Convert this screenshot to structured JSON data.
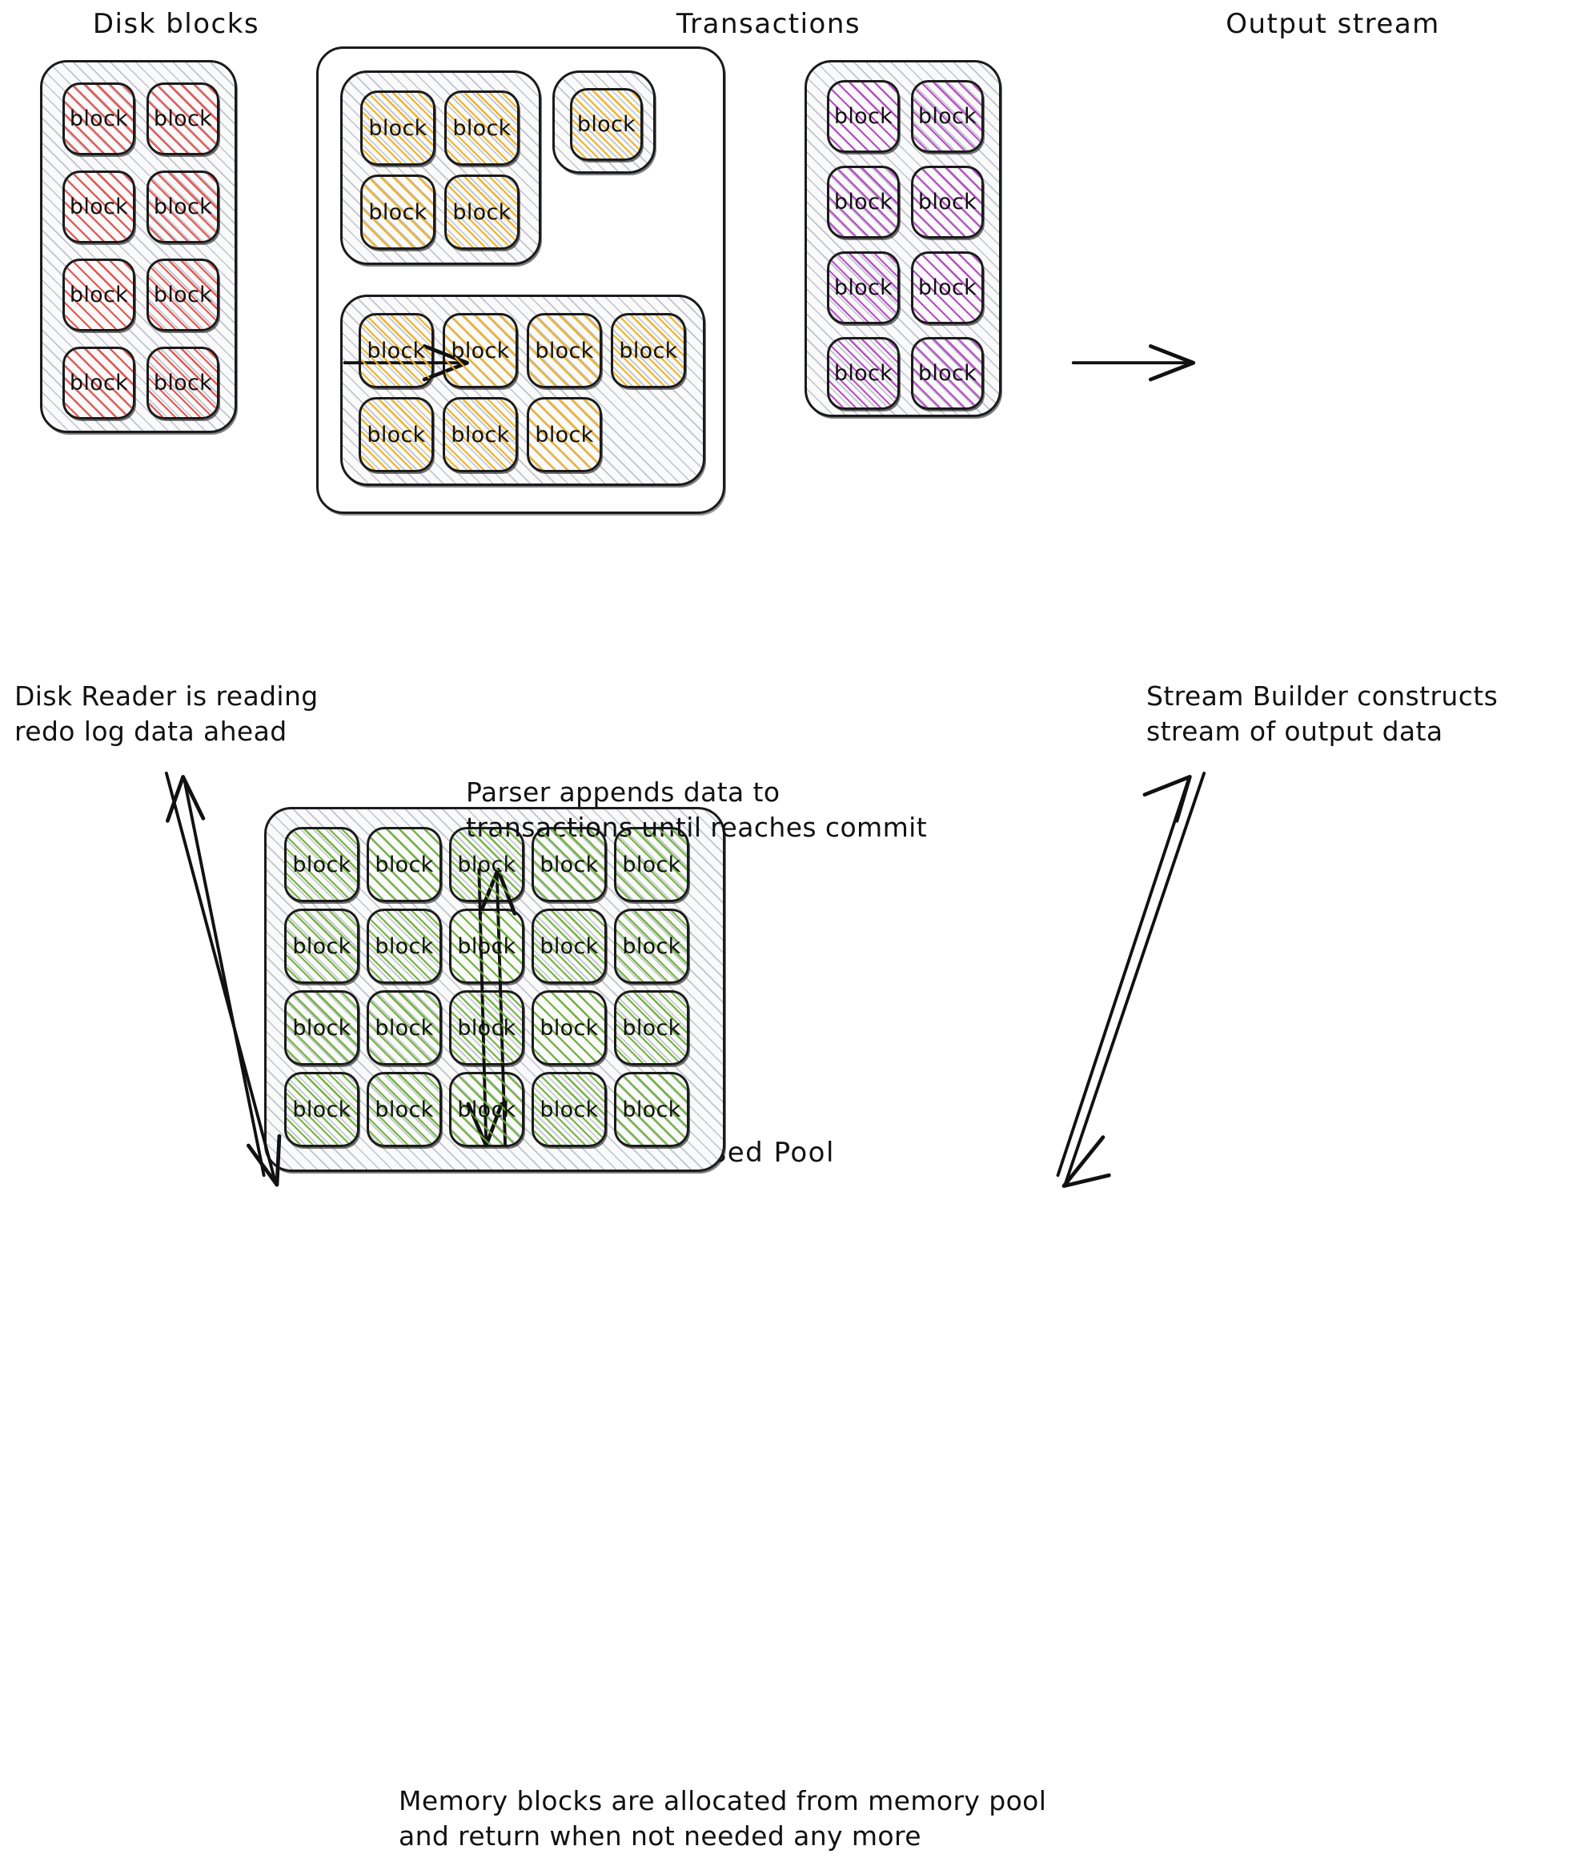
{
  "groups": {
    "disk": {
      "title": "Disk blocks",
      "block_label": "block",
      "rows": 4,
      "cols": 2,
      "count": 8,
      "color": "#e54e48",
      "blocks": [
        "block",
        "block",
        "block",
        "block",
        "block",
        "block",
        "block",
        "block"
      ]
    },
    "transactions": {
      "title": "Transactions",
      "block_label": "block",
      "color": "#f2af1c",
      "sub_boxes": [
        {
          "name": "transaction-a",
          "rows": 2,
          "cols": 2,
          "blocks": [
            "block",
            "block",
            "block",
            "block"
          ]
        },
        {
          "name": "transaction-b",
          "rows": 1,
          "cols": 1,
          "blocks": [
            "block"
          ]
        },
        {
          "name": "transaction-c",
          "rows": 2,
          "cols": 4,
          "blocks": [
            "block",
            "block",
            "block",
            "block",
            "block",
            "block",
            "block"
          ]
        }
      ]
    },
    "output": {
      "title": "Output stream",
      "block_label": "block",
      "rows": 4,
      "cols": 2,
      "count": 8,
      "color": "#b23fbf",
      "blocks": [
        "block",
        "block",
        "block",
        "block",
        "block",
        "block",
        "block",
        "block"
      ]
    },
    "pool": {
      "title": "Unused Pool",
      "block_label": "block",
      "rows": 4,
      "cols": 5,
      "count": 20,
      "color": "#68ae2f",
      "blocks": [
        "block",
        "block",
        "block",
        "block",
        "block",
        "block",
        "block",
        "block",
        "block",
        "block",
        "block",
        "block",
        "block",
        "block",
        "block",
        "block",
        "block",
        "block",
        "block",
        "block"
      ]
    }
  },
  "annotations": {
    "disk_reader": "Disk Reader is reading\nredo log data ahead",
    "parser": "Parser appends data to\ntransactions until reaches commit",
    "stream_builder": "Stream Builder constructs\nstream of output data",
    "memory_pool": "Memory blocks are allocated from memory pool\nand return when not needed any more"
  },
  "flow": {
    "disk_to_transactions": "arrow-right",
    "transactions_to_output": "arrow-right",
    "pool_disk": "bidirectional",
    "pool_transactions": "bidirectional",
    "pool_output": "bidirectional"
  }
}
